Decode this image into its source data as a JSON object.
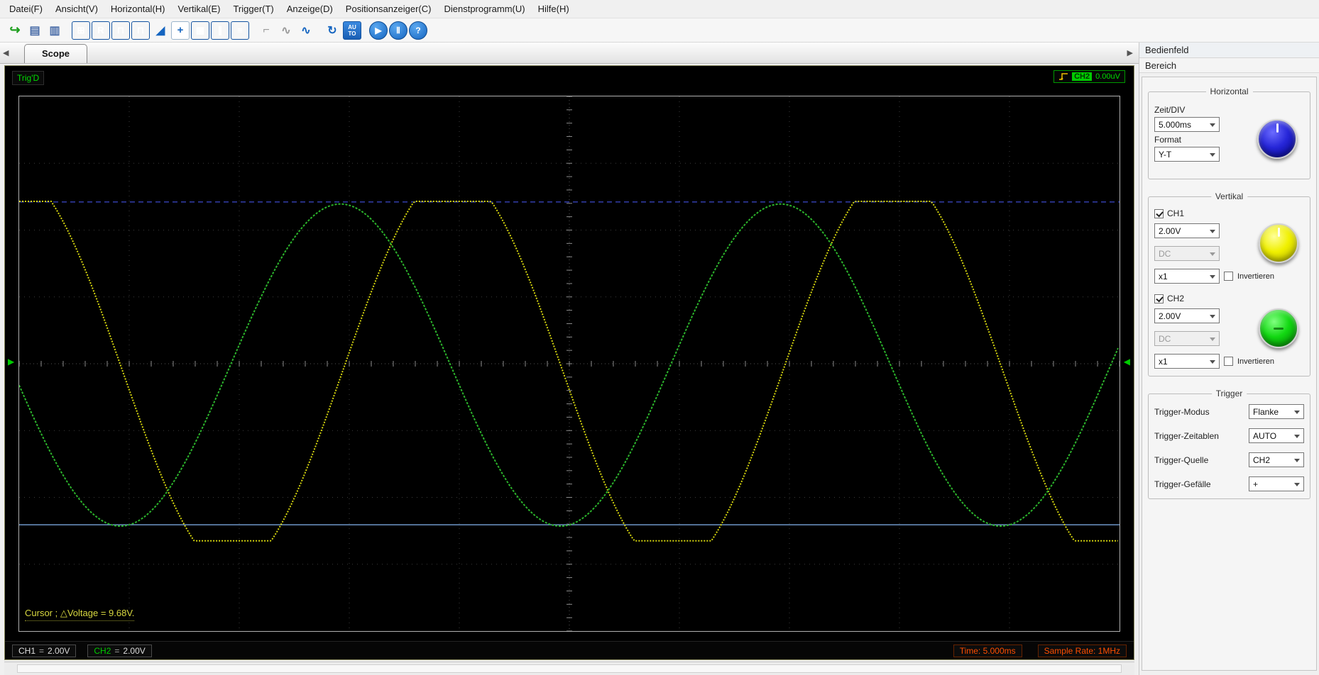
{
  "menu": {
    "items": [
      "Datei(F)",
      "Ansicht(V)",
      "Horizontal(H)",
      "Vertikal(E)",
      "Trigger(T)",
      "Anzeige(D)",
      "Positionsanzeiger(C)",
      "Dienstprogramm(U)",
      "Hilfe(H)"
    ]
  },
  "toolbar": {
    "icons": [
      {
        "name": "open-file-icon",
        "glyph": "↪"
      },
      {
        "name": "save-icon",
        "glyph": "▤"
      },
      {
        "name": "print-icon",
        "glyph": "▥"
      },
      {
        "name": "panel-setup-icon",
        "glyph": "⊞"
      },
      {
        "name": "recall-icon",
        "glyph": "R"
      },
      {
        "name": "waveform-pulse-icon",
        "glyph": "⊓"
      },
      {
        "name": "waveform-pulse2-icon",
        "glyph": "⊓"
      },
      {
        "name": "ramp-icon",
        "glyph": "◢"
      },
      {
        "name": "cursor-tool-icon",
        "glyph": "+"
      },
      {
        "name": "grid-display-icon",
        "glyph": "▦"
      },
      {
        "name": "vertical-cursors-icon",
        "glyph": "∥"
      },
      {
        "name": "horizontal-cursors-icon",
        "glyph": "≡"
      },
      {
        "name": "step-wave-icon",
        "glyph": "⌐"
      },
      {
        "name": "sine-wave-gray-icon",
        "glyph": "∿"
      },
      {
        "name": "sine-wave-icon",
        "glyph": "∿"
      },
      {
        "name": "refresh-icon",
        "glyph": "↻"
      },
      {
        "name": "autoset-icon",
        "glyph": "AU\nTO"
      },
      {
        "name": "run-icon",
        "glyph": "▶"
      },
      {
        "name": "pause-icon",
        "glyph": "Ⅱ"
      },
      {
        "name": "help-icon",
        "glyph": "?"
      }
    ]
  },
  "tabs": {
    "active": "Scope",
    "scroll_left": "◀",
    "scroll_right": "▶"
  },
  "scope": {
    "trig_status": "Trig'D",
    "trigger_readout": {
      "source": "CH2",
      "level": "0.00uV"
    },
    "cursor_readout": "Cursor ; △Voltage = 9.68V.",
    "marker_left": "▶",
    "marker_right": "◀",
    "footer": {
      "ch1_name": "CH1",
      "ch1_coupling": "=",
      "ch1_scale": "2.00V",
      "ch2_name": "CH2",
      "ch2_coupling": "=",
      "ch2_scale": "2.00V",
      "time": "Time: 5.000ms",
      "sample_rate": "Sample Rate: 1MHz"
    }
  },
  "panel": {
    "title": "Bedienfeld",
    "section": "Bereich",
    "horizontal": {
      "legend": "Horizontal",
      "zeit_label": "Zeit/DIV",
      "zeit_value": "5.000ms",
      "format_label": "Format",
      "format_value": "Y-T"
    },
    "vertikal": {
      "legend": "Vertikal",
      "ch1": {
        "name": "CH1",
        "scale": "2.00V",
        "coupling": "DC",
        "probe": "x1",
        "invert": "Invertieren",
        "enabled": true
      },
      "ch2": {
        "name": "CH2",
        "scale": "2.00V",
        "coupling": "DC",
        "probe": "x1",
        "invert": "Invertieren",
        "enabled": true
      }
    },
    "trigger": {
      "legend": "Trigger",
      "rows": [
        {
          "label": "Trigger-Modus",
          "value": "Flanke"
        },
        {
          "label": "Trigger-Zeitablen",
          "value": "AUTO"
        },
        {
          "label": "Trigger-Quelle",
          "value": "CH2"
        },
        {
          "label": "Trigger-Gefälle",
          "value": "+"
        }
      ]
    }
  },
  "chart_data": {
    "type": "line",
    "title": "Oscilloscope waveform display",
    "x": {
      "time_per_div_ms": 5.0,
      "divisions": 10,
      "total_ms": 50,
      "sample_rate": "1MHz"
    },
    "y": {
      "volts_per_div": 2.0,
      "divisions": 8
    },
    "grid": {
      "style": "dotted",
      "center_cross_ticks": true
    },
    "series": [
      {
        "name": "CH1",
        "color": "#d6d60e",
        "waveform": "clipped-sine",
        "period_div": 4,
        "period_ms": 20,
        "frequency_hz": 50,
        "amplitude_div": 2.98,
        "clip_div": 2.54,
        "offset_div": 0.11,
        "peak_x_div": -0.06,
        "dash": "2 2"
      },
      {
        "name": "CH2",
        "color": "#2cb42c",
        "waveform": "sine",
        "period_div": 4,
        "period_ms": 20,
        "frequency_hz": 50,
        "amplitude_div": 2.41,
        "clip_div": null,
        "offset_div": 0.02,
        "peak_x_div": 2.92,
        "dash": "3 2"
      }
    ],
    "cursors": {
      "type": "horizontal-voltage",
      "y1_div": -2.42,
      "y2_div": 2.41,
      "delta_voltage": "9.68V",
      "line1_color": "#4b5cff",
      "line2_color": "#6e96c8"
    }
  }
}
